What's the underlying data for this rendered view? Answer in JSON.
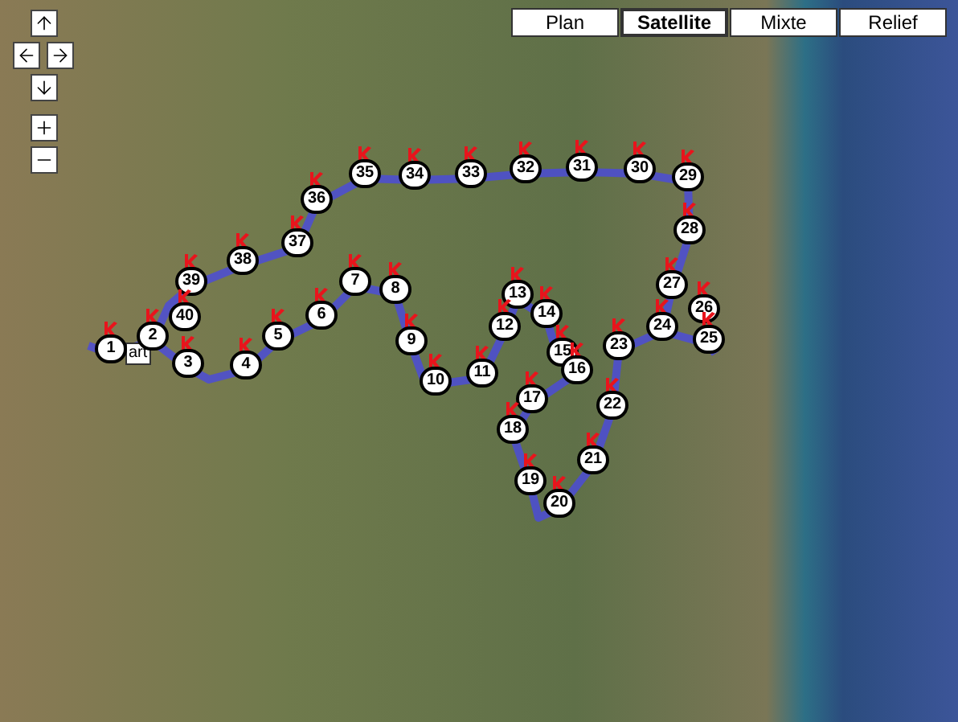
{
  "map_types": [
    {
      "label": "Plan",
      "selected": false
    },
    {
      "label": "Satellite",
      "selected": true
    },
    {
      "label": "Mixte",
      "selected": false
    },
    {
      "label": "Relief",
      "selected": false
    }
  ],
  "start_label": "art",
  "markers": [
    {
      "label": "35"
    },
    {
      "label": "34"
    },
    {
      "label": "33"
    },
    {
      "label": "32"
    },
    {
      "label": "31"
    },
    {
      "label": "30"
    },
    {
      "label": "29"
    },
    {
      "label": "36"
    },
    {
      "label": "28"
    },
    {
      "label": "37"
    },
    {
      "label": "38"
    },
    {
      "label": "39"
    },
    {
      "label": "7"
    },
    {
      "label": "8"
    },
    {
      "label": "13"
    },
    {
      "label": "27"
    },
    {
      "label": "40"
    },
    {
      "label": "6"
    },
    {
      "label": "14"
    },
    {
      "label": "26"
    },
    {
      "label": "2"
    },
    {
      "label": "5"
    },
    {
      "label": "9"
    },
    {
      "label": "12"
    },
    {
      "label": "24"
    },
    {
      "label": "25"
    },
    {
      "label": "1"
    },
    {
      "label": "15"
    },
    {
      "label": "23"
    },
    {
      "label": "3"
    },
    {
      "label": "4"
    },
    {
      "label": "10"
    },
    {
      "label": "11"
    },
    {
      "label": "16"
    },
    {
      "label": "17"
    },
    {
      "label": "22"
    },
    {
      "label": "18"
    },
    {
      "label": "21"
    },
    {
      "label": "19"
    },
    {
      "label": "20"
    }
  ]
}
